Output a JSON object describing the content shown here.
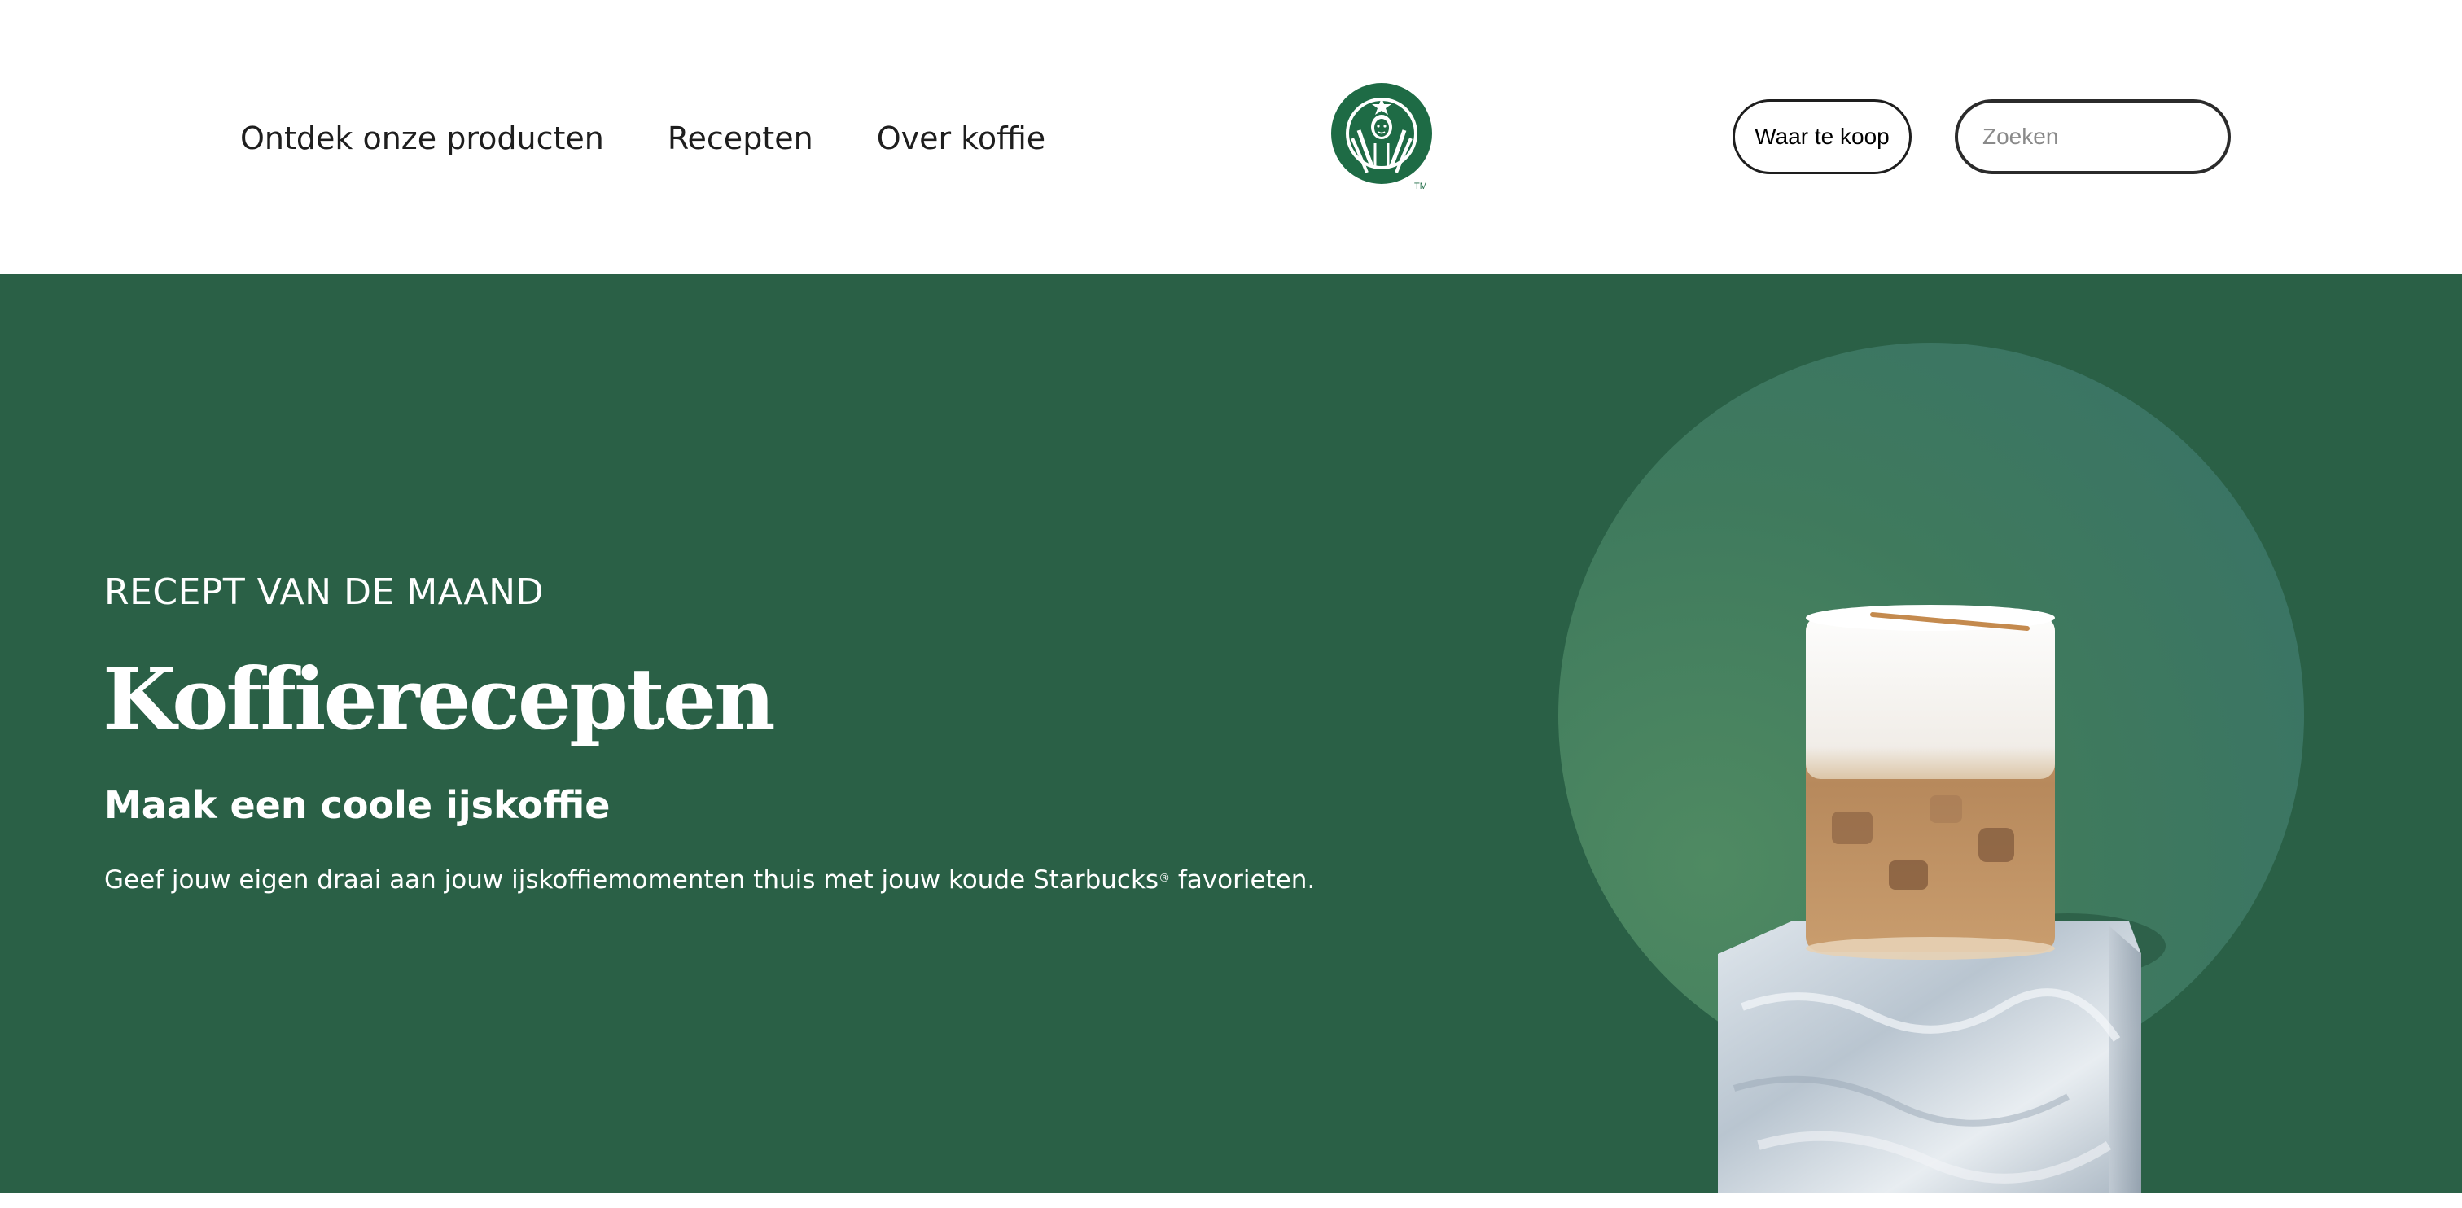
{
  "header": {
    "nav": [
      {
        "label": "Ontdek onze producten"
      },
      {
        "label": "Recepten"
      },
      {
        "label": "Over koffie"
      }
    ],
    "logo_icon": "starbucks-siren-logo",
    "logo_trademark": "TM",
    "where_to_buy_label": "Waar te koop",
    "search": {
      "placeholder": "Zoeken",
      "value": ""
    }
  },
  "hero": {
    "eyebrow": "RECEPT VAN DE MAAND",
    "title": "Koffierecepten",
    "subtitle": "Maak een coole ijskoffie",
    "description_main": "Geef jouw eigen draai aan jouw ijskoffiemomenten thuis met jouw koude Starbucks",
    "description_reg": "®",
    "description_end": " favorieten.",
    "image": "iced-coffee-glass-on-ice-cube"
  },
  "colors": {
    "brand_green": "#2a6046",
    "logo_green": "#1e6b45",
    "text_dark": "#1e1e1e"
  }
}
